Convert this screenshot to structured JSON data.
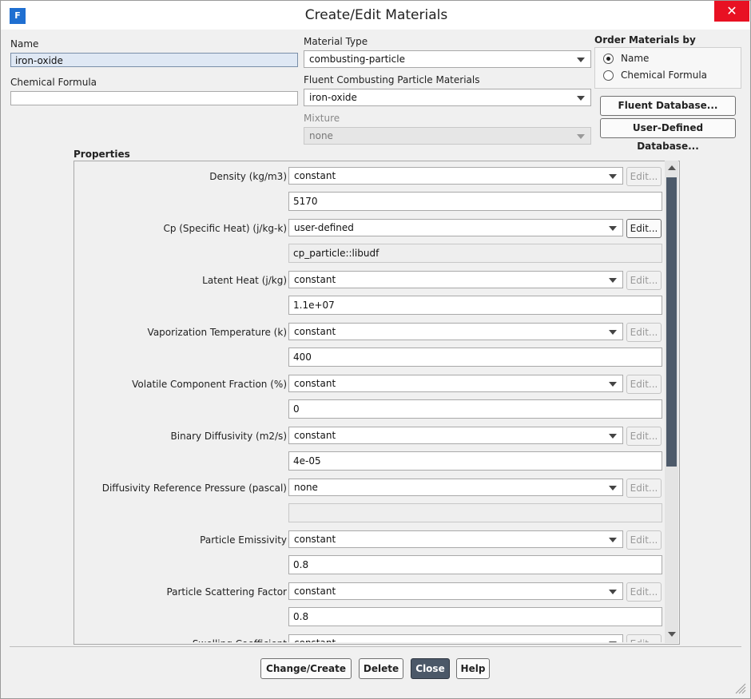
{
  "window": {
    "title": "Create/Edit Materials",
    "app_icon": "F"
  },
  "name": {
    "label": "Name",
    "value": "iron-oxide"
  },
  "chemical_formula": {
    "label": "Chemical Formula",
    "value": ""
  },
  "material_type": {
    "label": "Material Type",
    "value": "combusting-particle"
  },
  "fluent_materials": {
    "label": "Fluent Combusting Particle Materials",
    "value": "iron-oxide"
  },
  "mixture": {
    "label": "Mixture",
    "value": "none"
  },
  "order_by": {
    "label": "Order Materials by",
    "options": [
      "Name",
      "Chemical Formula"
    ],
    "selected": "Name"
  },
  "db_buttons": {
    "fluent": "Fluent Database...",
    "user": "User-Defined Database..."
  },
  "properties_label": "Properties",
  "edit_label": "Edit...",
  "properties": [
    {
      "label": "Density (kg/m3)",
      "method": "constant",
      "value": "5170",
      "edit_enabled": false
    },
    {
      "label": "Cp (Specific Heat) (j/kg-k)",
      "method": "user-defined",
      "value": "cp_particle::libudf",
      "edit_enabled": true
    },
    {
      "label": "Latent Heat (j/kg)",
      "method": "constant",
      "value": "1.1e+07",
      "edit_enabled": false
    },
    {
      "label": "Vaporization Temperature (k)",
      "method": "constant",
      "value": "400",
      "edit_enabled": false
    },
    {
      "label": "Volatile Component Fraction (%)",
      "method": "constant",
      "value": "0",
      "edit_enabled": false
    },
    {
      "label": "Binary Diffusivity (m2/s)",
      "method": "constant",
      "value": "4e-05",
      "edit_enabled": false
    },
    {
      "label": "Diffusivity Reference Pressure (pascal)",
      "method": "none",
      "value": "",
      "edit_enabled": false
    },
    {
      "label": "Particle Emissivity",
      "method": "constant",
      "value": "0.8",
      "edit_enabled": false
    },
    {
      "label": "Particle Scattering Factor",
      "method": "constant",
      "value": "0.8",
      "edit_enabled": false
    },
    {
      "label": "Swelling Coefficient",
      "method": "constant",
      "value": "",
      "edit_enabled": false
    }
  ],
  "footer": {
    "change": "Change/Create",
    "delete": "Delete",
    "close": "Close",
    "help": "Help"
  },
  "colors": {
    "close_button": "#4b5868",
    "title_close": "#e81123",
    "scroll_thumb": "#4d5a6a"
  }
}
